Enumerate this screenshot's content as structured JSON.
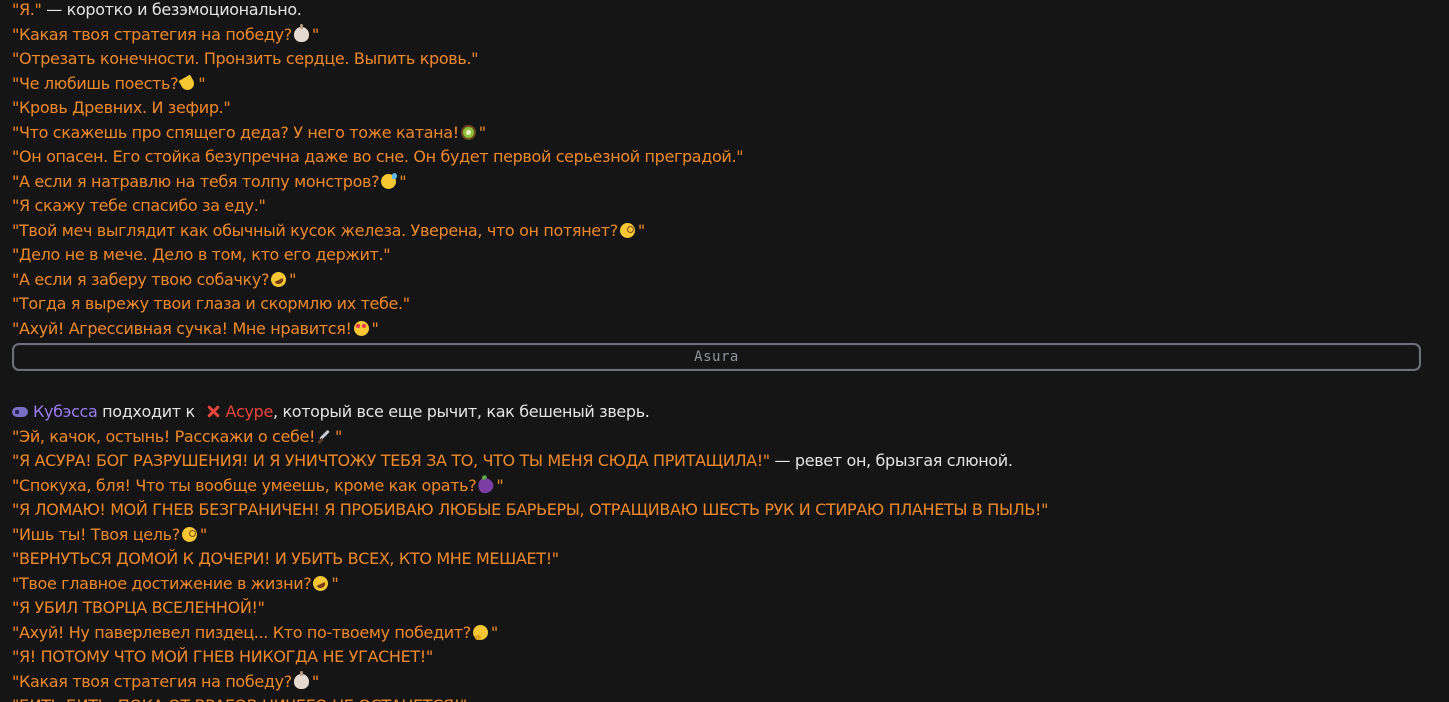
{
  "block1": {
    "lines": [
      {
        "q": "\"Я.\"",
        "n": " — коротко и безэмоционально."
      },
      {
        "q": "\"Какая твоя стратегия на победу?",
        "icon": "garlic-icon",
        "end": "\""
      },
      {
        "q": "\"Отрезать конечности. Пронзить сердце. Выпить кровь.\""
      },
      {
        "q": "\"Че любишь поесть?",
        "icon": "banana-icon",
        "end": "\""
      },
      {
        "q": "\"Кровь Древних. И зефир.\""
      },
      {
        "q": "\"Что скажешь про спящего деда? У него тоже катана!",
        "icon": "kiwi-icon",
        "end": "\""
      },
      {
        "q": "\"Он опасен. Его стойка безупречна даже во сне. Он будет первой серьезной преградой.\""
      },
      {
        "q": "\"А если я натравлю на тебя толпу монстров?",
        "icon": "sweat-smile-icon",
        "end": "\""
      },
      {
        "q": "\"Я скажу тебе спасибо за еду.\""
      },
      {
        "q": "\"Твой меч выглядит как обычный кусок железа. Уверена, что он потянет?",
        "icon": "monocle-face-icon",
        "end": "\""
      },
      {
        "q": "\"Дело не в мече. Дело в том, кто его держит.\""
      },
      {
        "q": "\"А если я заберу твою собачку?",
        "icon": "rofl-icon",
        "end": "\""
      },
      {
        "q": "\"Тогда я вырежу твои глаза и скормлю их тебе.\""
      },
      {
        "q": "\"Ахуй! Агрессивная сучка! Мне нравится!",
        "icon": "heart-eyes-icon",
        "end": "\""
      }
    ]
  },
  "divider": {
    "label": "Asura"
  },
  "intro": {
    "name1": "Кубэсса",
    "mid": " подходит к ",
    "name2": "Асуре",
    "rest": ", который все еще рычит, как бешеный зверь."
  },
  "block2": {
    "lines": [
      {
        "q": "\"Эй, качок, остынь! Расскажи о себе!",
        "icon": "knife-icon",
        "end": "\""
      },
      {
        "q": "\"Я АСУРА! БОГ РАЗРУШЕНИЯ! И Я УНИЧТОЖУ ТЕБЯ ЗА ТО, ЧТО ТЫ МЕНЯ СЮДА ПРИТАЩИЛА!\"",
        "n": " — ревет он, брызгая слюной."
      },
      {
        "q": "\"Спокуха, бля! Что ты вообще умеешь, кроме как орать?",
        "icon": "eggplant-icon",
        "end": "\""
      },
      {
        "q": "\"Я ЛОМАЮ! МОЙ ГНЕВ БЕЗГРАНИЧЕН! Я ПРОБИВАЮ ЛЮБЫЕ БАРЬЕРЫ, ОТРАЩИВАЮ ШЕСТЬ РУК И СТИРАЮ ПЛАНЕТЫ В ПЫЛЬ!\""
      },
      {
        "q": "\"Ишь ты! Твоя цель?",
        "icon": "monocle-face-icon",
        "end": "\""
      },
      {
        "q": "\"ВЕРНУТЬСЯ ДОМОЙ К ДОЧЕРИ! И УБИТЬ ВСЕХ, КТО МНЕ МЕШАЕТ!\""
      },
      {
        "q": "\"Твое главное достижение в жизни?",
        "icon": "rofl-icon",
        "end": "\""
      },
      {
        "q": "\"Я УБИЛ ТВОРЦА ВСЕЛЕННОЙ!\""
      },
      {
        "q": "\"Ахуй! Ну паверлевел пиздец... Кто по-твоему победит?",
        "icon": "thinking-face-icon",
        "end": "\""
      },
      {
        "q": "\"Я! ПОТОМУ ЧТО МОЙ ГНЕВ НИКОГДА НЕ УГАСНЕТ!\""
      },
      {
        "q": "\"Какая твоя стратегия на победу?",
        "icon": "garlic-icon",
        "end": "\""
      },
      {
        "q": "\"БИТЬ БИТЬ, ПОКА ОТ ВРАГОВ НИЧЕГО НЕ ОСТАНЕТСЯ!\""
      }
    ]
  }
}
